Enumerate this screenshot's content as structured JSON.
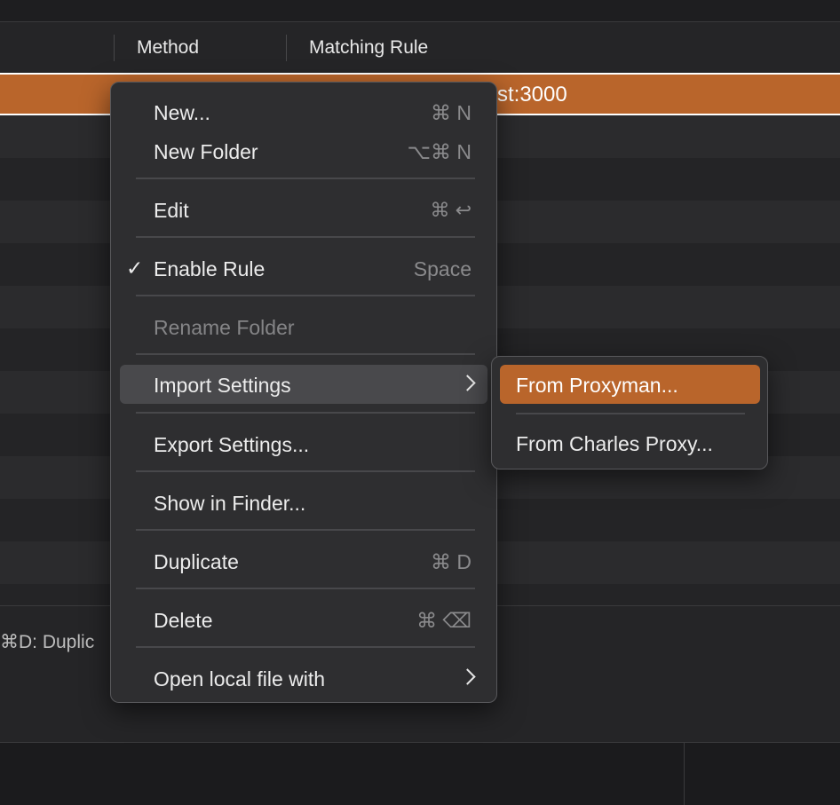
{
  "table": {
    "columns": [
      "Method",
      "Matching Rule"
    ],
    "selected_row_text": "st:3000",
    "hint_text": "⌘D: Duplic"
  },
  "context_menu": {
    "items": [
      {
        "label": "New...",
        "shortcut": "⌘ N"
      },
      {
        "label": "New Folder",
        "shortcut": "⌥⌘ N"
      },
      {
        "label": "Edit",
        "shortcut": "⌘ ↩"
      },
      {
        "label": "Enable Rule",
        "shortcut": "Space",
        "checked": true,
        "check": "✓"
      },
      {
        "label": "Rename Folder",
        "disabled": true
      },
      {
        "label": "Import Settings",
        "submenu": true,
        "highlighted": true
      },
      {
        "label": "Export Settings..."
      },
      {
        "label": "Show in Finder..."
      },
      {
        "label": "Duplicate",
        "shortcut": "⌘ D"
      },
      {
        "label": "Delete",
        "shortcut": "⌘ ⌫"
      },
      {
        "label": "Open local file with",
        "submenu": true
      }
    ]
  },
  "submenu": {
    "items": [
      {
        "label": "From Proxyman...",
        "active": true
      },
      {
        "label": "From Charles Proxy..."
      }
    ]
  },
  "colors": {
    "accent": "#b9652b",
    "menu_bg": "#2e2e30",
    "background": "#242426"
  },
  "icons": {
    "check": "checkmark-icon",
    "submenu": "chevron-right-icon"
  }
}
